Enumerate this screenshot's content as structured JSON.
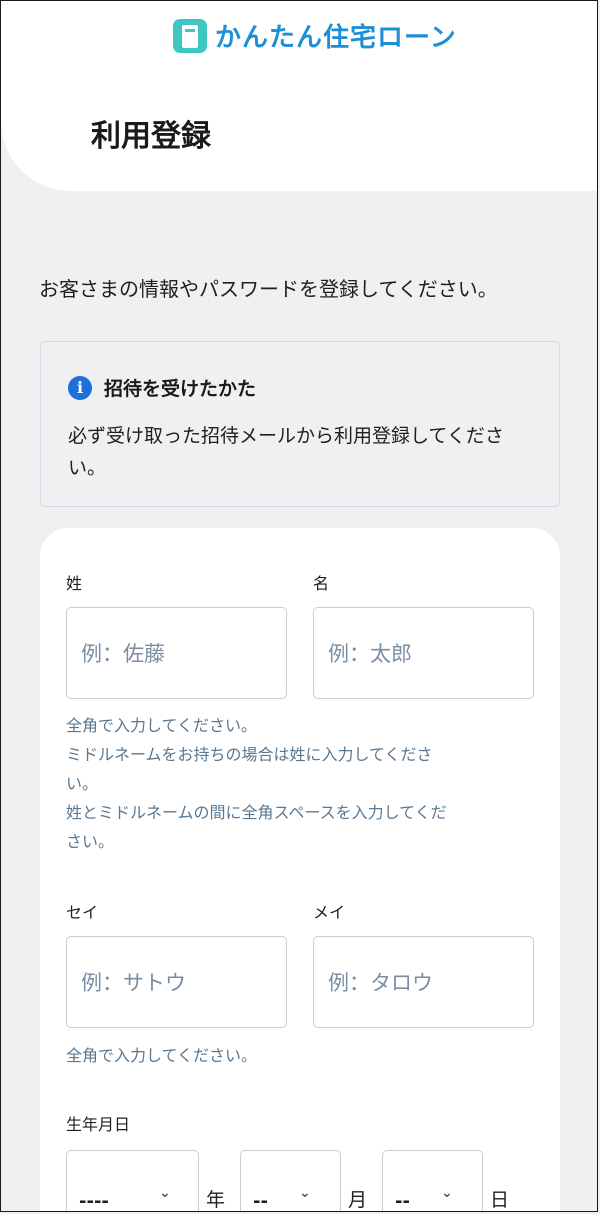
{
  "brand": {
    "name": "かんたん住宅ローン"
  },
  "page": {
    "title": "利用登録",
    "intro": "お客さまの情報やパスワードを登録してください。"
  },
  "notice": {
    "icon": "info-icon",
    "title": "招待を受けたかた",
    "body": "必ず受け取った招待メールから利用登録してください。"
  },
  "form": {
    "last_name": {
      "label": "姓",
      "placeholder": "例：佐藤"
    },
    "first_name": {
      "label": "名",
      "placeholder": "例：太郎"
    },
    "name_help": [
      "全角で入力してください。",
      "ミドルネームをお持ちの場合は姓に入力してくださ",
      "い。",
      "姓とミドルネームの間に全角スペースを入力してくだ",
      "さい。"
    ],
    "last_kana": {
      "label": "セイ",
      "placeholder": "例：サトウ"
    },
    "first_kana": {
      "label": "メイ",
      "placeholder": "例：タロウ"
    },
    "kana_help": "全角で入力してください。",
    "birthdate": {
      "label": "生年月日",
      "year": {
        "value": "----",
        "unit": "年"
      },
      "month": {
        "value": "--",
        "unit": "月"
      },
      "day": {
        "value": "--",
        "unit": "日"
      }
    }
  },
  "colors": {
    "brand": "#1d8fd6",
    "logo_icon": "#3ec6c0",
    "info": "#1f6fd9",
    "help_text": "#5a7891"
  }
}
